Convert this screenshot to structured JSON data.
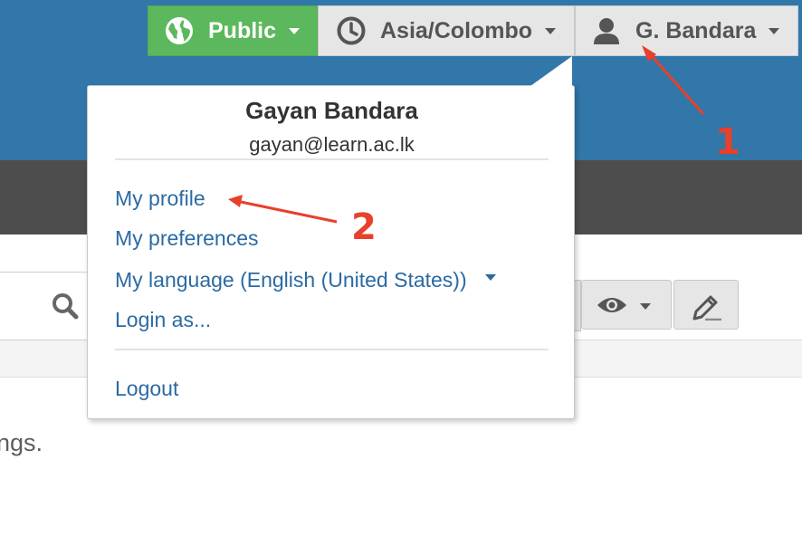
{
  "topbar": {
    "public_label": "Public",
    "timezone_label": "Asia/Colombo",
    "user_label": "G. Bandara"
  },
  "user_menu": {
    "full_name": "Gayan Bandara",
    "email": "gayan@learn.ac.lk",
    "items": [
      "My profile",
      "My preferences",
      "My language (English (United States))",
      "Login as..."
    ],
    "logout_label": "Logout"
  },
  "content": {
    "text_fragment": "ngs."
  },
  "annotations": {
    "marker_1": "1",
    "marker_2": "2"
  },
  "colors": {
    "header_blue": "#3177a9",
    "nav_dark": "#4d4d4d",
    "public_green": "#5cb85c",
    "link_blue": "#2b6aa3",
    "annotation_red": "#e8402a"
  },
  "icons": {
    "public": "globe-icon",
    "timezone": "clock-icon",
    "user": "user-icon",
    "search": "search-icon",
    "view": "eye-icon",
    "edit": "pencil-icon"
  }
}
